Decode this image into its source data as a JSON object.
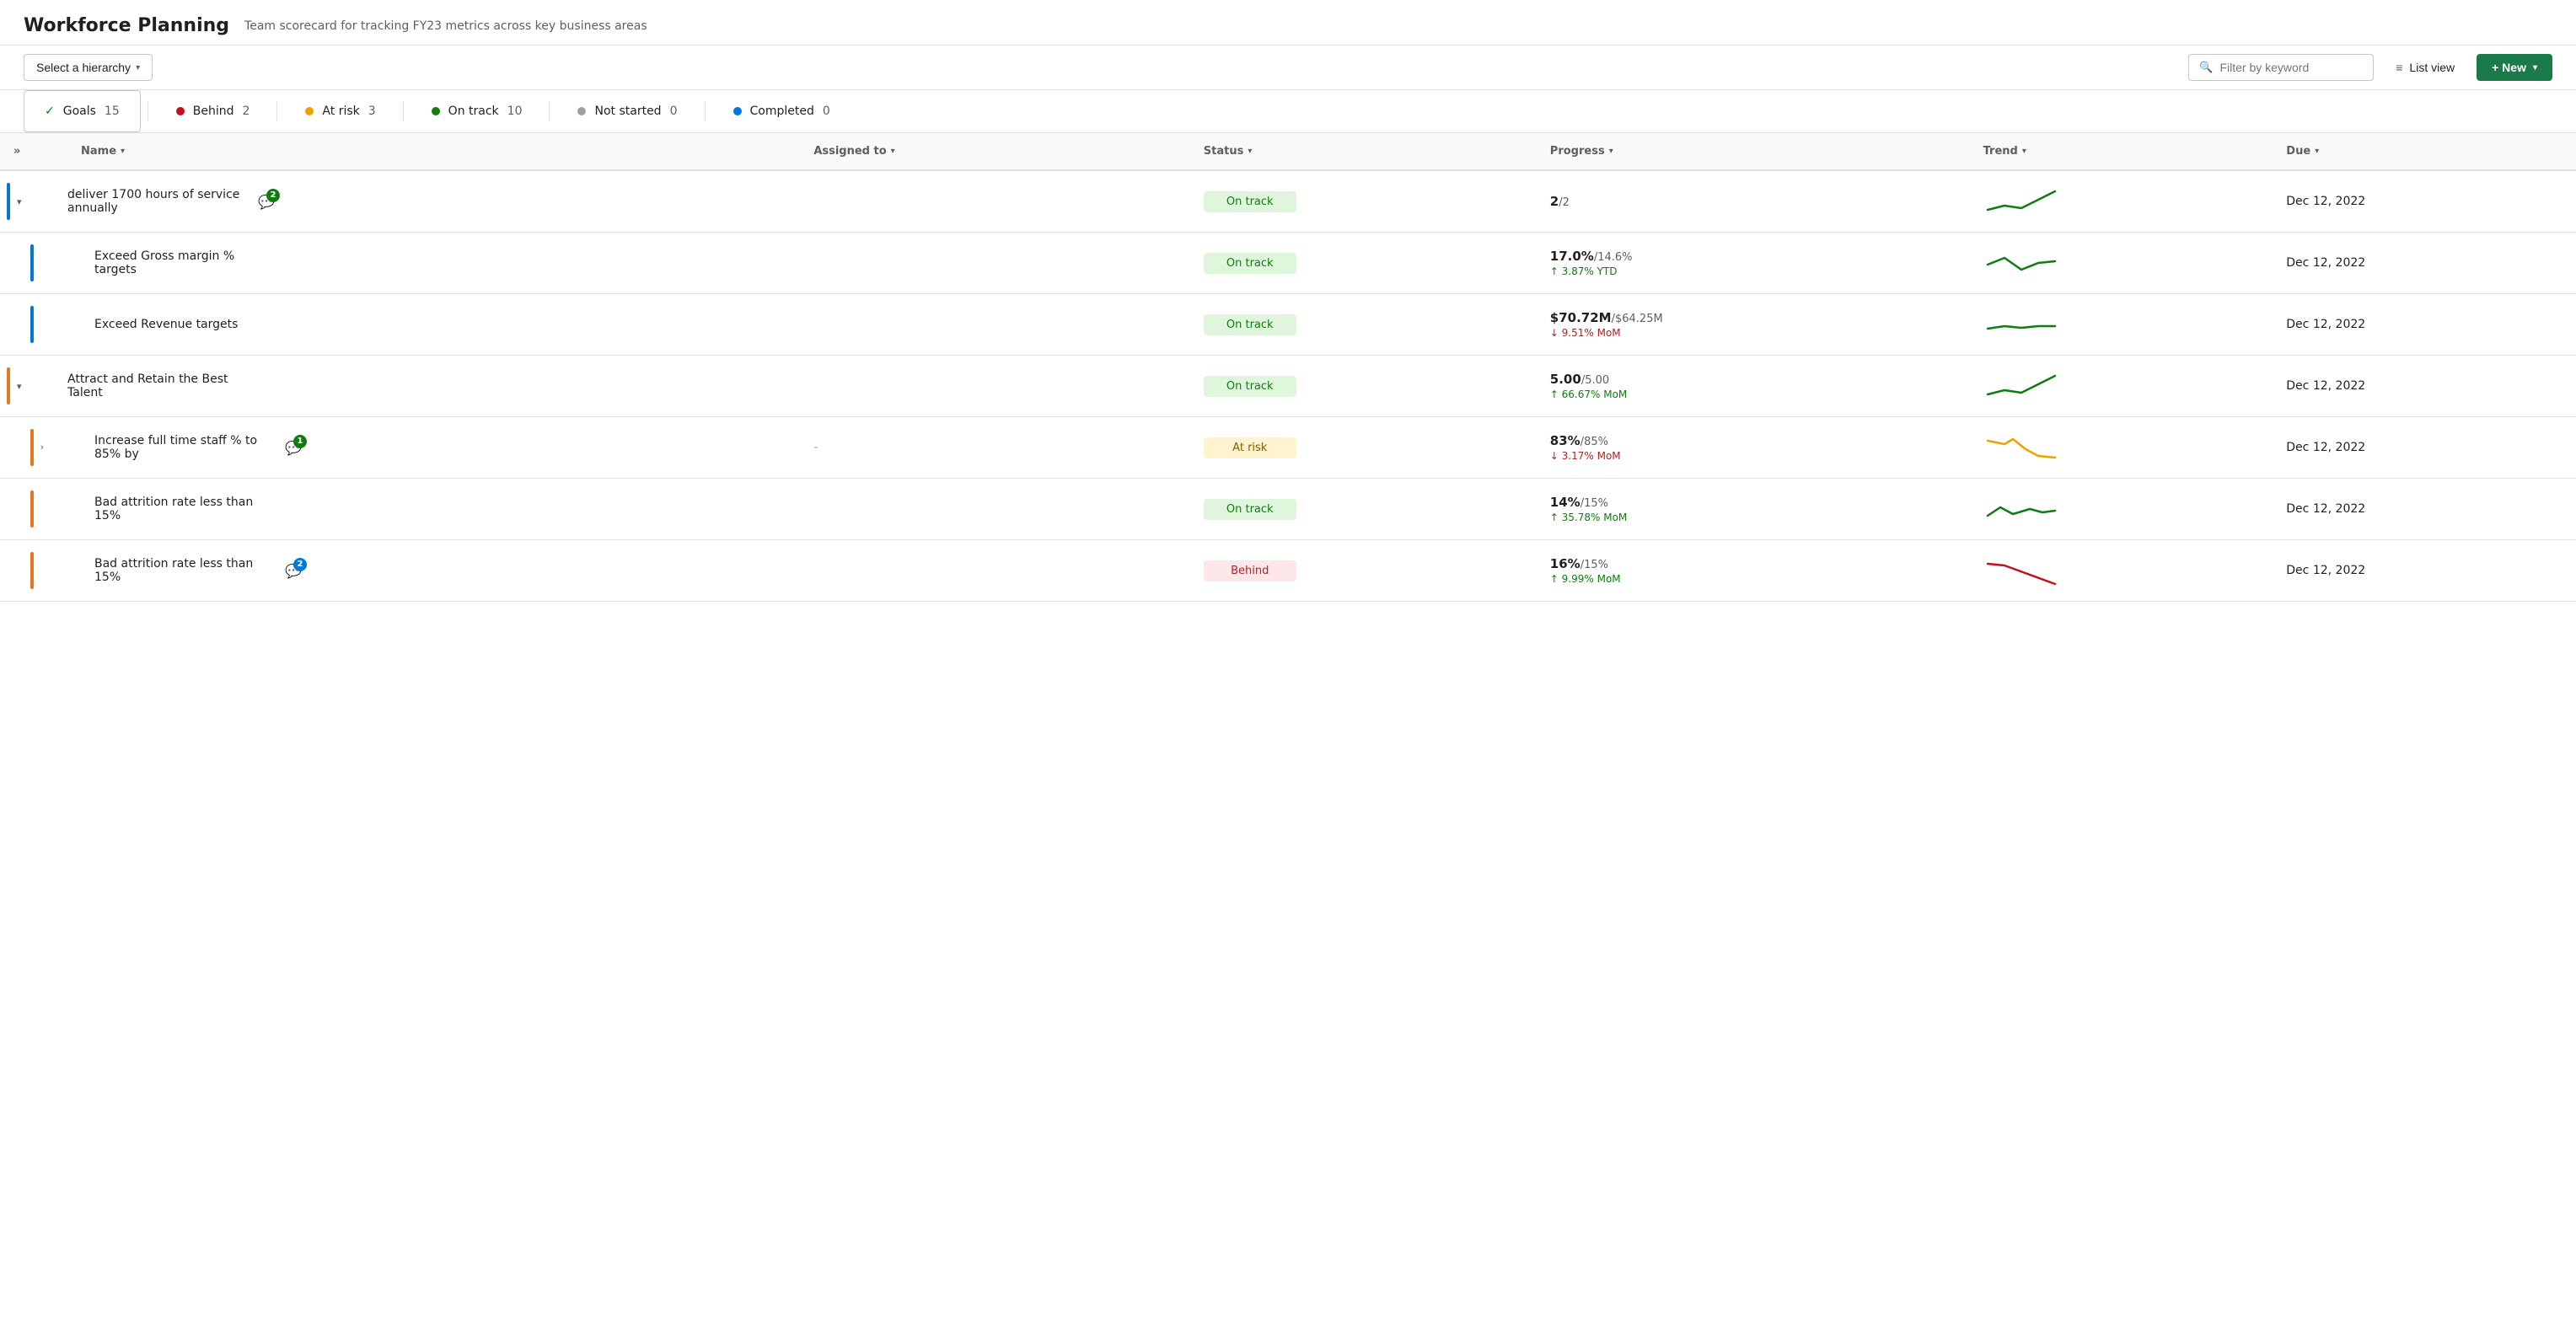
{
  "app": {
    "title": "Workforce Planning",
    "subtitle": "Team scorecard for tracking FY23 metrics across key business areas"
  },
  "toolbar": {
    "hierarchy_label": "Select a hierarchy",
    "filter_placeholder": "Filter by keyword",
    "list_view_label": "List view",
    "new_label": "+ New"
  },
  "stats": {
    "goals_label": "Goals",
    "goals_count": "15",
    "behind_label": "Behind",
    "behind_count": "2",
    "at_risk_label": "At risk",
    "at_risk_count": "3",
    "on_track_label": "On track",
    "on_track_count": "10",
    "not_started_label": "Not started",
    "not_started_count": "0",
    "completed_label": "Completed",
    "completed_count": "0"
  },
  "table": {
    "columns": {
      "name": "Name",
      "assigned_to": "Assigned to",
      "status": "Status",
      "progress": "Progress",
      "trend": "Trend",
      "due": "Due"
    },
    "rows": [
      {
        "id": "row-1",
        "level": 0,
        "color": "#0078d4",
        "expandable": true,
        "expanded": true,
        "name": "deliver 1700 hours of service annually",
        "comment_count": "2",
        "comment_color": "green",
        "assigned": "",
        "status": "On track",
        "status_class": "status-on-track",
        "progress_main": "2",
        "progress_target": "/2",
        "progress_sub": "",
        "progress_dir": "",
        "due": "Dec 12, 2022",
        "trend_type": "up_green",
        "action_icons": false
      },
      {
        "id": "row-2",
        "level": 1,
        "color": "#0078d4",
        "expandable": false,
        "expanded": false,
        "name": "Exceed Gross margin % targets",
        "comment_count": "",
        "comment_color": "",
        "assigned": "",
        "status": "On track",
        "status_class": "status-on-track",
        "progress_main": "17.0%",
        "progress_target": "/14.6%",
        "progress_sub": "↑ 3.87% YTD",
        "progress_dir": "up",
        "due": "Dec 12, 2022",
        "trend_type": "up_down_green",
        "action_icons": false
      },
      {
        "id": "row-3",
        "level": 1,
        "color": "#0078d4",
        "expandable": false,
        "expanded": false,
        "name": "Exceed Revenue targets",
        "comment_count": "",
        "comment_color": "",
        "assigned": "",
        "status": "On track",
        "status_class": "status-on-track",
        "progress_main": "$70.72M",
        "progress_target": "/$64.25M",
        "progress_sub": "↓ 9.51% MoM",
        "progress_dir": "down",
        "due": "Dec 12, 2022",
        "trend_type": "flat_green",
        "action_icons": false
      },
      {
        "id": "row-4",
        "level": 0,
        "color": "#e87722",
        "expandable": true,
        "expanded": true,
        "name": "Attract and Retain the Best Talent",
        "comment_count": "",
        "comment_color": "",
        "assigned": "",
        "status": "On track",
        "status_class": "status-on-track",
        "progress_main": "5.00",
        "progress_target": "/5.00",
        "progress_sub": "↑ 66.67% MoM",
        "progress_dir": "up",
        "due": "Dec 12, 2022",
        "trend_type": "up_green",
        "action_icons": true
      },
      {
        "id": "row-5",
        "level": 1,
        "color": "#e87722",
        "expandable": true,
        "expanded": false,
        "name": "Increase full time staff % to 85% by",
        "comment_count": "1",
        "comment_color": "green",
        "assigned": "-",
        "status": "At risk",
        "status_class": "status-at-risk",
        "progress_main": "83%",
        "progress_target": "/85%",
        "progress_sub": "↓ 3.17% MoM",
        "progress_dir": "down",
        "due": "Dec 12, 2022",
        "trend_type": "down_yellow",
        "action_icons": false
      },
      {
        "id": "row-6",
        "level": 1,
        "color": "#e87722",
        "expandable": false,
        "expanded": false,
        "name": "Bad attrition rate less than 15%",
        "comment_count": "",
        "comment_color": "",
        "assigned": "",
        "status": "On track",
        "status_class": "status-on-track",
        "progress_main": "14%",
        "progress_target": "/15%",
        "progress_sub": "↑ 35.78% MoM",
        "progress_dir": "up",
        "due": "Dec 12, 2022",
        "trend_type": "wave_green",
        "action_icons": false
      },
      {
        "id": "row-7",
        "level": 1,
        "color": "#e87722",
        "expandable": false,
        "expanded": false,
        "name": "Bad attrition rate less than 15%",
        "comment_count": "2",
        "comment_color": "blue",
        "assigned": "",
        "status": "Behind",
        "status_class": "status-behind",
        "progress_main": "16%",
        "progress_target": "/15%",
        "progress_sub": "↑ 9.99% MoM",
        "progress_dir": "up",
        "due": "Dec 12, 2022",
        "trend_type": "down_red",
        "action_icons": false
      }
    ]
  }
}
